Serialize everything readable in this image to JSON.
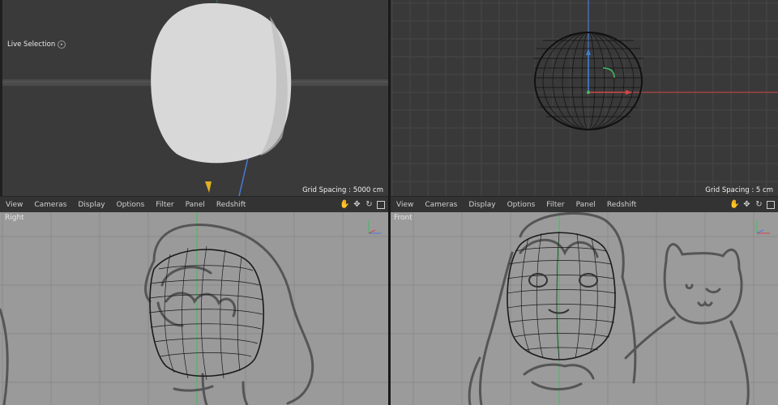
{
  "viewports": {
    "perspective": {
      "tool_label": "Live Selection",
      "grid_spacing": "Grid Spacing : 5000 cm",
      "colors": {
        "bg": "#3a3a3a",
        "horizon": "#505050",
        "model": "#d9d9d9"
      }
    },
    "top": {
      "grid_spacing": "Grid Spacing : 5 cm",
      "colors": {
        "bg": "#393939",
        "grid": "#474747"
      }
    },
    "right": {
      "label": "Right",
      "menu": [
        "View",
        "Cameras",
        "Display",
        "Options",
        "Filter",
        "Panel",
        "Redshift"
      ],
      "colors": {
        "bg": "#9a9a9a",
        "grid": "#8a8a8a"
      }
    },
    "front": {
      "label": "Front",
      "menu": [
        "View",
        "Cameras",
        "Display",
        "Options",
        "Filter",
        "Panel",
        "Redshift"
      ],
      "colors": {
        "bg": "#9b9b9b",
        "grid": "#8b8b8b"
      }
    }
  },
  "viewport_icons": [
    "hand-pan-icon",
    "move-arrows-icon",
    "rotate-icon",
    "maximize-icon"
  ],
  "axis_colors": {
    "x": "#d64545",
    "y": "#3fbf5f",
    "z": "#4a7ad6"
  }
}
